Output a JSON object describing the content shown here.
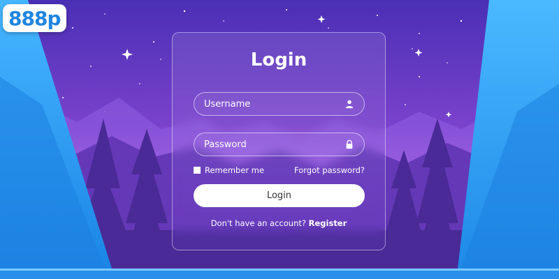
{
  "brand": {
    "logo_text": "888p",
    "logo_color": "#1f86e0"
  },
  "login_card": {
    "title": "Login",
    "username": {
      "placeholder": "Username",
      "icon": "user-icon"
    },
    "password": {
      "placeholder": "Password",
      "icon": "lock-icon"
    },
    "remember_label": "Remember me",
    "forgot_label": "Forgot password?",
    "submit_label": "Login",
    "register_prompt": "Don't have an account?",
    "register_label": "Register"
  },
  "colors": {
    "sky_top": "#4a2fb5",
    "sky_horizon": "#c56ce8",
    "frame_blue": "#2a9ff2",
    "button_bg": "#ffffff",
    "text": "#ffffff"
  }
}
